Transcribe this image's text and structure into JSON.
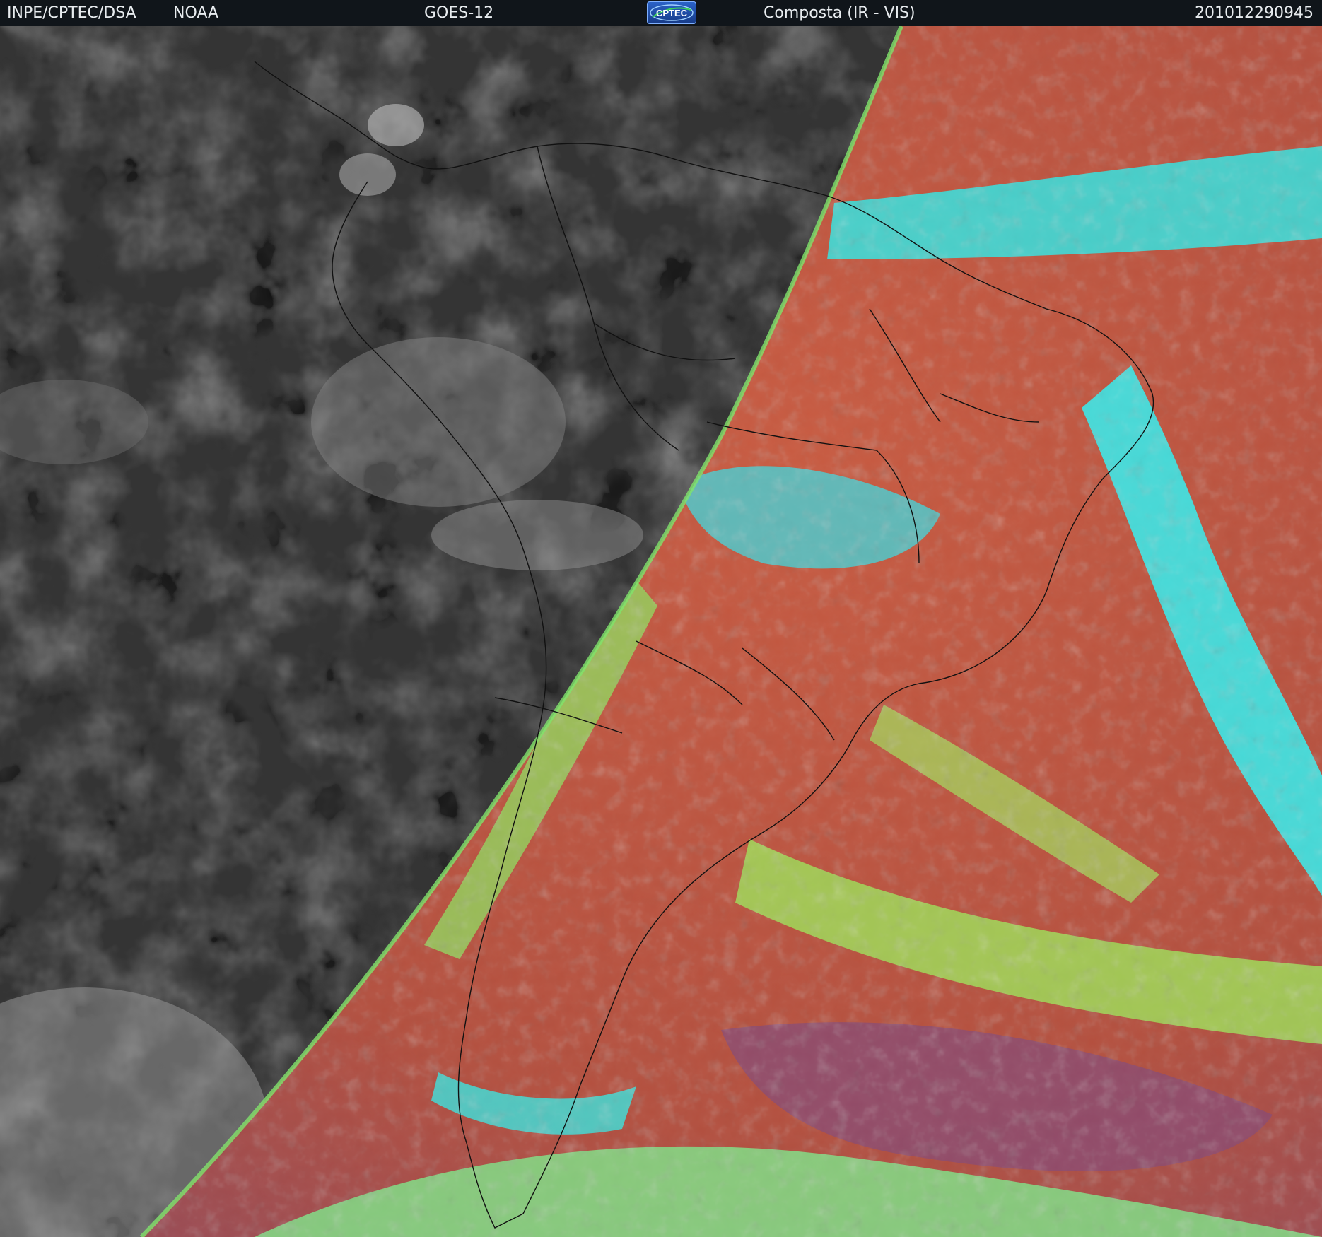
{
  "header": {
    "org": "INPE/CPTEC/DSA",
    "agency": "NOAA",
    "satellite": "GOES-12",
    "logo_text": "CPTEC",
    "product": "Composta (IR - VIS)",
    "timestamp": "201012290945"
  },
  "image": {
    "subject": "satellite composite",
    "night_tone": "#3a3a3a",
    "day_colors": {
      "surface": "#b8553e",
      "low_cloud": "#8fe060",
      "high_cloud": "#2ee8e6",
      "cold_cloud": "#8a4a6a"
    }
  }
}
